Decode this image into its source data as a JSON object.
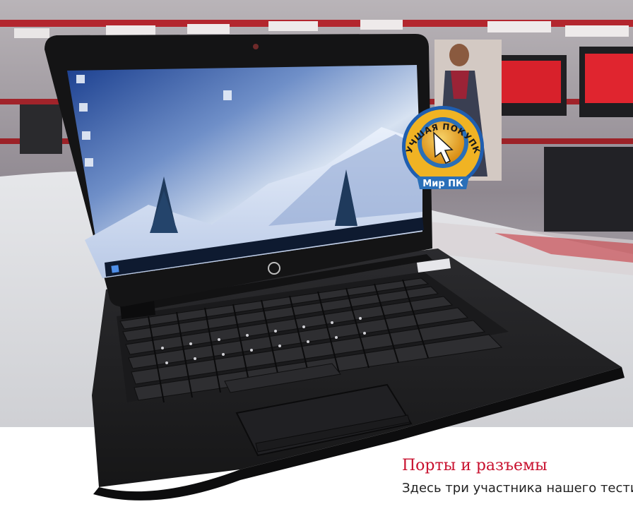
{
  "article": {
    "heading": "Порты и разъемы",
    "body_line": "Здесь три участника нашего тестиро-"
  },
  "badge": {
    "ring_text": "ЛУЧШАЯ ПОКУПКА",
    "brand": "Мир ПК"
  },
  "colors": {
    "accent_red": "#c8102e",
    "badge_gold": "#f0b323",
    "badge_blue": "#2a6fb8",
    "laptop_body": "#1c1c1e"
  }
}
